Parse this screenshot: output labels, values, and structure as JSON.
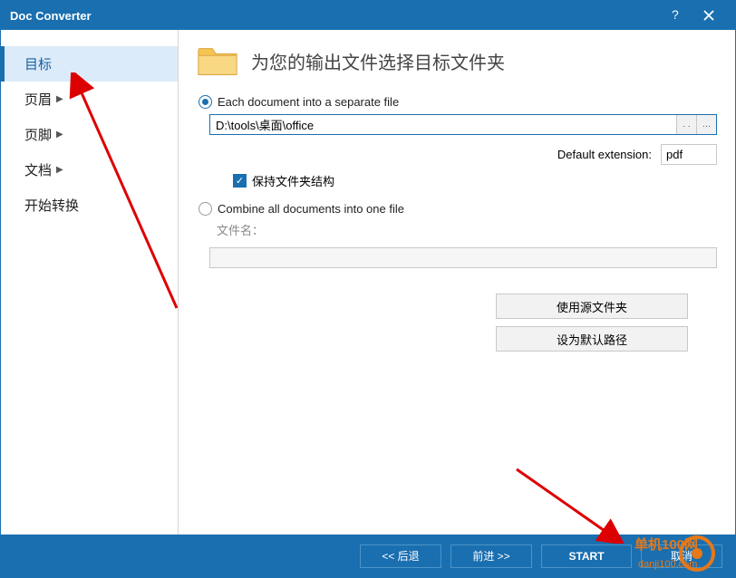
{
  "titlebar": {
    "title": "Doc Converter"
  },
  "sidebar": {
    "items": [
      {
        "label": "目标",
        "has_chevron": false,
        "selected": true
      },
      {
        "label": "页眉",
        "has_chevron": true,
        "selected": false
      },
      {
        "label": "页脚",
        "has_chevron": true,
        "selected": false
      },
      {
        "label": "文档",
        "has_chevron": true,
        "selected": false
      },
      {
        "label": "开始转换",
        "has_chevron": false,
        "selected": false
      }
    ]
  },
  "main": {
    "heading": "为您的输出文件选择目标文件夹",
    "radio_each_label": "Each document into a separate file",
    "path_value": "D:\\tools\\桌面\\office",
    "default_ext_label": "Default extension:",
    "default_ext_value": "pdf",
    "keep_structure_label": "保持文件夹结构",
    "radio_combine_label": "Combine all documents into one file",
    "filename_label": "文件名：",
    "btn_use_source": "使用源文件夹",
    "btn_set_default": "设为默认路径"
  },
  "footer": {
    "back": "<< 后退",
    "forward": "前进 >>",
    "start": "START",
    "cancel": "取消"
  },
  "watermark": {
    "line1": "单机100网",
    "line2": "danji100.com"
  }
}
